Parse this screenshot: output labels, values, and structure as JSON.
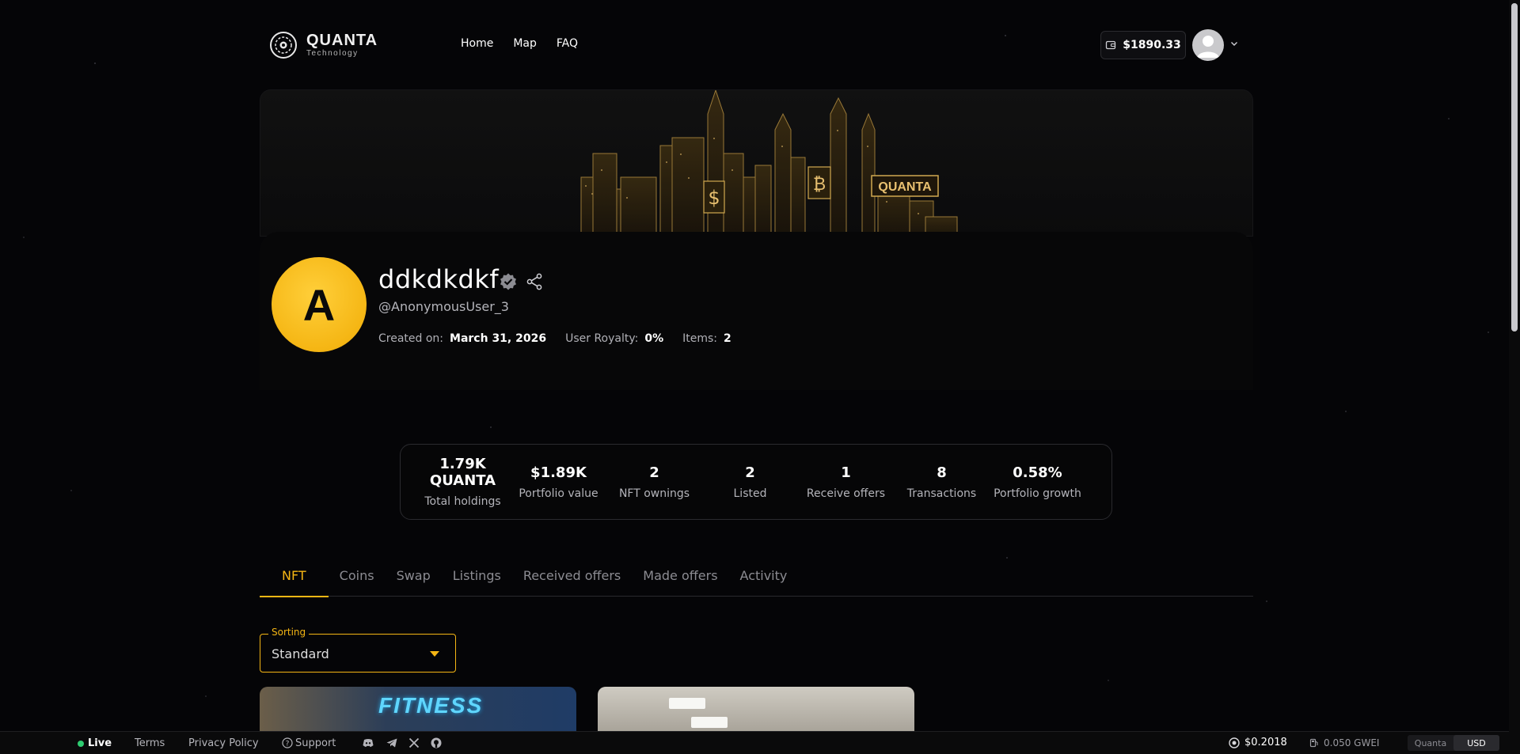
{
  "brand": {
    "name": "QUANTA",
    "sub": "Technology"
  },
  "nav": {
    "links": [
      "Home",
      "Map",
      "FAQ"
    ]
  },
  "wallet": {
    "balance": "$1890.33"
  },
  "banner": {
    "sign_text": "QUANTA",
    "dollar": "$",
    "bitcoin": "₿"
  },
  "profile": {
    "avatar_letter": "A",
    "name": "ddkdkdkf",
    "handle": "@AnonymousUser_3",
    "created_label": "Created on:",
    "created_value": "March 31, 2026",
    "royalty_label": "User Royalty:",
    "royalty_value": "0%",
    "items_label": "Items:",
    "items_value": "2"
  },
  "stats": [
    {
      "value": "1.79K QUANTA",
      "label": "Total holdings"
    },
    {
      "value": "$1.89K",
      "label": "Portfolio value"
    },
    {
      "value": "2",
      "label": "NFT ownings"
    },
    {
      "value": "2",
      "label": "Listed"
    },
    {
      "value": "1",
      "label": "Receive offers"
    },
    {
      "value": "8",
      "label": "Transactions"
    },
    {
      "value": "0.58%",
      "label": "Portfolio growth"
    }
  ],
  "tabs": [
    "NFT",
    "Coins",
    "Swap",
    "Listings",
    "Received offers",
    "Made offers",
    "Activity"
  ],
  "sorting": {
    "legend": "Sorting",
    "value": "Standard"
  },
  "cards": {
    "card1_text": "FITNESS"
  },
  "footer": {
    "live": "Live",
    "terms": "Terms",
    "privacy": "Privacy Policy",
    "support": "Support",
    "price": "$0.2018",
    "gas": "0.050 GWEI",
    "toggle_left": "Quanta",
    "toggle_right": "USD"
  },
  "colors": {
    "accent": "#f5b614",
    "live": "#2ecc71"
  }
}
